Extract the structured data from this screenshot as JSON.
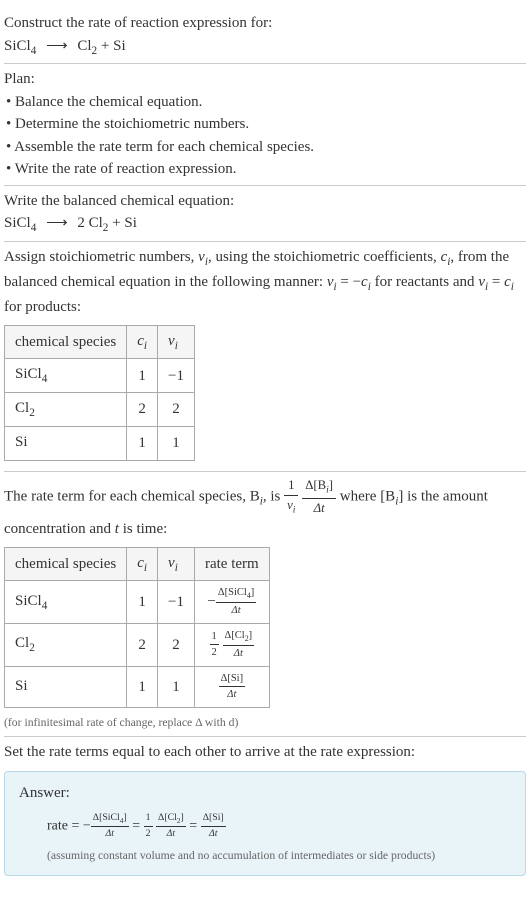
{
  "intro": {
    "prompt": "Construct the rate of reaction expression for:",
    "equation_lhs": "SiCl",
    "equation_lhs_sub": "4",
    "arrow": "⟶",
    "equation_rhs_1": "Cl",
    "equation_rhs_1_sub": "2",
    "equation_rhs_plus": " + ",
    "equation_rhs_2": "Si"
  },
  "plan": {
    "title": "Plan:",
    "items": [
      "• Balance the chemical equation.",
      "• Determine the stoichiometric numbers.",
      "• Assemble the rate term for each chemical species.",
      "• Write the rate of reaction expression."
    ]
  },
  "balanced": {
    "title": "Write the balanced chemical equation:",
    "lhs": "SiCl",
    "lhs_sub": "4",
    "arrow": "⟶",
    "coef": "2 ",
    "rhs_1": "Cl",
    "rhs_1_sub": "2",
    "plus": " + ",
    "rhs_2": "Si"
  },
  "stoich": {
    "text_1": "Assign stoichiometric numbers, ",
    "nu_i": "ν",
    "nu_i_sub": "i",
    "text_2": ", using the stoichiometric coefficients, ",
    "c_i": "c",
    "c_i_sub": "i",
    "text_3": ", from the balanced chemical equation in the following manner: ",
    "eq1_lhs": "ν",
    "eq1_lhs_sub": "i",
    "eq1_eq": " = −",
    "eq1_rhs": "c",
    "eq1_rhs_sub": "i",
    "text_4": " for reactants and ",
    "eq2_lhs": "ν",
    "eq2_lhs_sub": "i",
    "eq2_eq": " = ",
    "eq2_rhs": "c",
    "eq2_rhs_sub": "i",
    "text_5": " for products:"
  },
  "table1": {
    "headers": {
      "species": "chemical species",
      "ci": "c",
      "ci_sub": "i",
      "nui": "ν",
      "nui_sub": "i"
    },
    "rows": [
      {
        "species": "SiCl",
        "species_sub": "4",
        "ci": "1",
        "nui": "−1"
      },
      {
        "species": "Cl",
        "species_sub": "2",
        "ci": "2",
        "nui": "2"
      },
      {
        "species": "Si",
        "species_sub": "",
        "ci": "1",
        "nui": "1"
      }
    ]
  },
  "rate_term": {
    "text_1": "The rate term for each chemical species, B",
    "bi_sub": "i",
    "text_2": ", is ",
    "frac1_num": "1",
    "frac1_den_nu": "ν",
    "frac1_den_sub": "i",
    "frac2_num": "Δ[B",
    "frac2_num_sub": "i",
    "frac2_num_close": "]",
    "frac2_den": "Δt",
    "text_3": " where [B",
    "text_3_sub": "i",
    "text_4": "] is the amount concentration and ",
    "t_var": "t",
    "text_5": " is time:"
  },
  "table2": {
    "headers": {
      "species": "chemical species",
      "ci": "c",
      "ci_sub": "i",
      "nui": "ν",
      "nui_sub": "i",
      "rate": "rate term"
    },
    "rows": [
      {
        "species": "SiCl",
        "species_sub": "4",
        "ci": "1",
        "nui": "−1",
        "rate_neg": "−",
        "rate_coef_num": "",
        "rate_coef_den": "",
        "rate_num": "Δ[SiCl",
        "rate_num_sub": "4",
        "rate_num_close": "]",
        "rate_den": "Δt"
      },
      {
        "species": "Cl",
        "species_sub": "2",
        "ci": "2",
        "nui": "2",
        "rate_neg": "",
        "rate_coef_num": "1",
        "rate_coef_den": "2",
        "rate_num": "Δ[Cl",
        "rate_num_sub": "2",
        "rate_num_close": "]",
        "rate_den": "Δt"
      },
      {
        "species": "Si",
        "species_sub": "",
        "ci": "1",
        "nui": "1",
        "rate_neg": "",
        "rate_coef_num": "",
        "rate_coef_den": "",
        "rate_num": "Δ[Si]",
        "rate_num_sub": "",
        "rate_num_close": "",
        "rate_den": "Δt"
      }
    ],
    "note": "(for infinitesimal rate of change, replace Δ with d)"
  },
  "final": {
    "title": "Set the rate terms equal to each other to arrive at the rate expression:"
  },
  "answer": {
    "title": "Answer:",
    "rate_label": "rate = −",
    "t1_num": "Δ[SiCl",
    "t1_num_sub": "4",
    "t1_num_close": "]",
    "t1_den": "Δt",
    "eq": " = ",
    "coef_num": "1",
    "coef_den": "2",
    "t2_num": "Δ[Cl",
    "t2_num_sub": "2",
    "t2_num_close": "]",
    "t2_den": "Δt",
    "t3_num": "Δ[Si]",
    "t3_den": "Δt",
    "note": "(assuming constant volume and no accumulation of intermediates or side products)"
  }
}
